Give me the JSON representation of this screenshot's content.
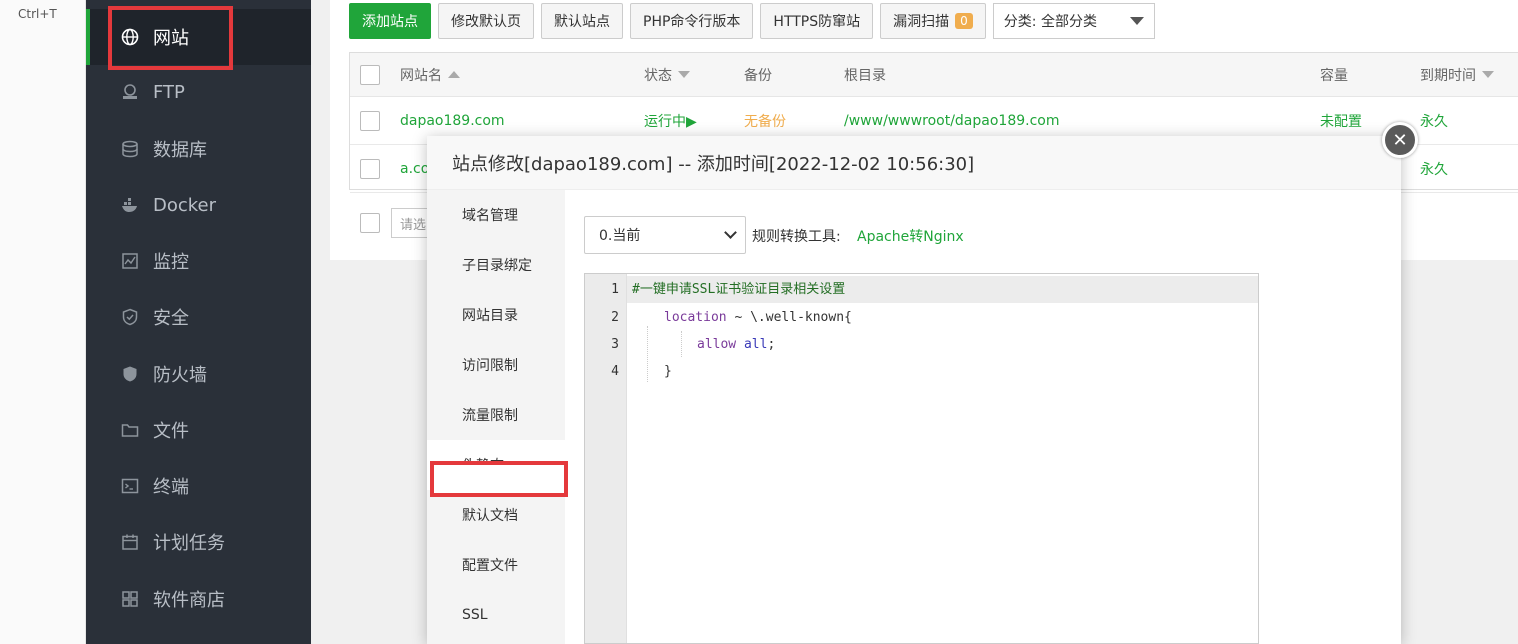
{
  "shortcut_hint": "Ctrl+T",
  "sidebar": {
    "items": [
      {
        "label": "网站",
        "icon": "globe-icon",
        "active": true
      },
      {
        "label": "FTP",
        "icon": "ftp-icon"
      },
      {
        "label": "数据库",
        "icon": "database-icon"
      },
      {
        "label": "Docker",
        "icon": "docker-icon"
      },
      {
        "label": "监控",
        "icon": "monitor-icon"
      },
      {
        "label": "安全",
        "icon": "shield-icon"
      },
      {
        "label": "防火墙",
        "icon": "firewall-icon"
      },
      {
        "label": "文件",
        "icon": "folder-icon"
      },
      {
        "label": "终端",
        "icon": "terminal-icon"
      },
      {
        "label": "计划任务",
        "icon": "calendar-icon"
      },
      {
        "label": "软件商店",
        "icon": "apps-icon"
      }
    ]
  },
  "toolbar": {
    "add_site": "添加站点",
    "edit_default_page": "修改默认页",
    "default_site": "默认站点",
    "php_cli": "PHP命令行版本",
    "https_firewall": "HTTPS防窜站",
    "vuln_scan": "漏洞扫描",
    "vuln_count": "0",
    "category": "分类: 全部分类"
  },
  "table": {
    "headers": {
      "name": "网站名",
      "status": "状态",
      "backup": "备份",
      "root": "根目录",
      "quota": "容量",
      "expire": "到期时间"
    },
    "rows": [
      {
        "name": "dapao189.com",
        "status": "运行中▶",
        "backup": "无备份",
        "root": "/www/wwwroot/dapao189.com",
        "quota": "未配置",
        "expire": "永久"
      },
      {
        "name": "a.co",
        "expire": "永久"
      }
    ],
    "bulk_placeholder": "请选"
  },
  "modal": {
    "title": "站点修改[dapao189.com] -- 添加时间[2022-12-02 10:56:30]",
    "tabs": [
      "域名管理",
      "子目录绑定",
      "网站目录",
      "访问限制",
      "流量限制",
      "伪静态",
      "默认文档",
      "配置文件",
      "SSL"
    ],
    "active_tab_index": 5,
    "version_select": "0.当前",
    "tool_label": "规则转换工具:",
    "tool_link": "Apache转Nginx",
    "editor": {
      "line_numbers": [
        "1",
        "2",
        "3",
        "4"
      ],
      "line1": "#一键申请SSL证书验证目录相关设置",
      "line2_kw": "location",
      "line2_rest": " ~ \\.well-known{",
      "line3_kw": "allow",
      "line3_val": "all",
      "line3_end": ";",
      "line4": "}"
    }
  },
  "colors": {
    "accent": "#20a53a",
    "sidebar_bg": "#2a3039",
    "warning": "#f0ad4e",
    "highlight_box": "#e4393c"
  }
}
